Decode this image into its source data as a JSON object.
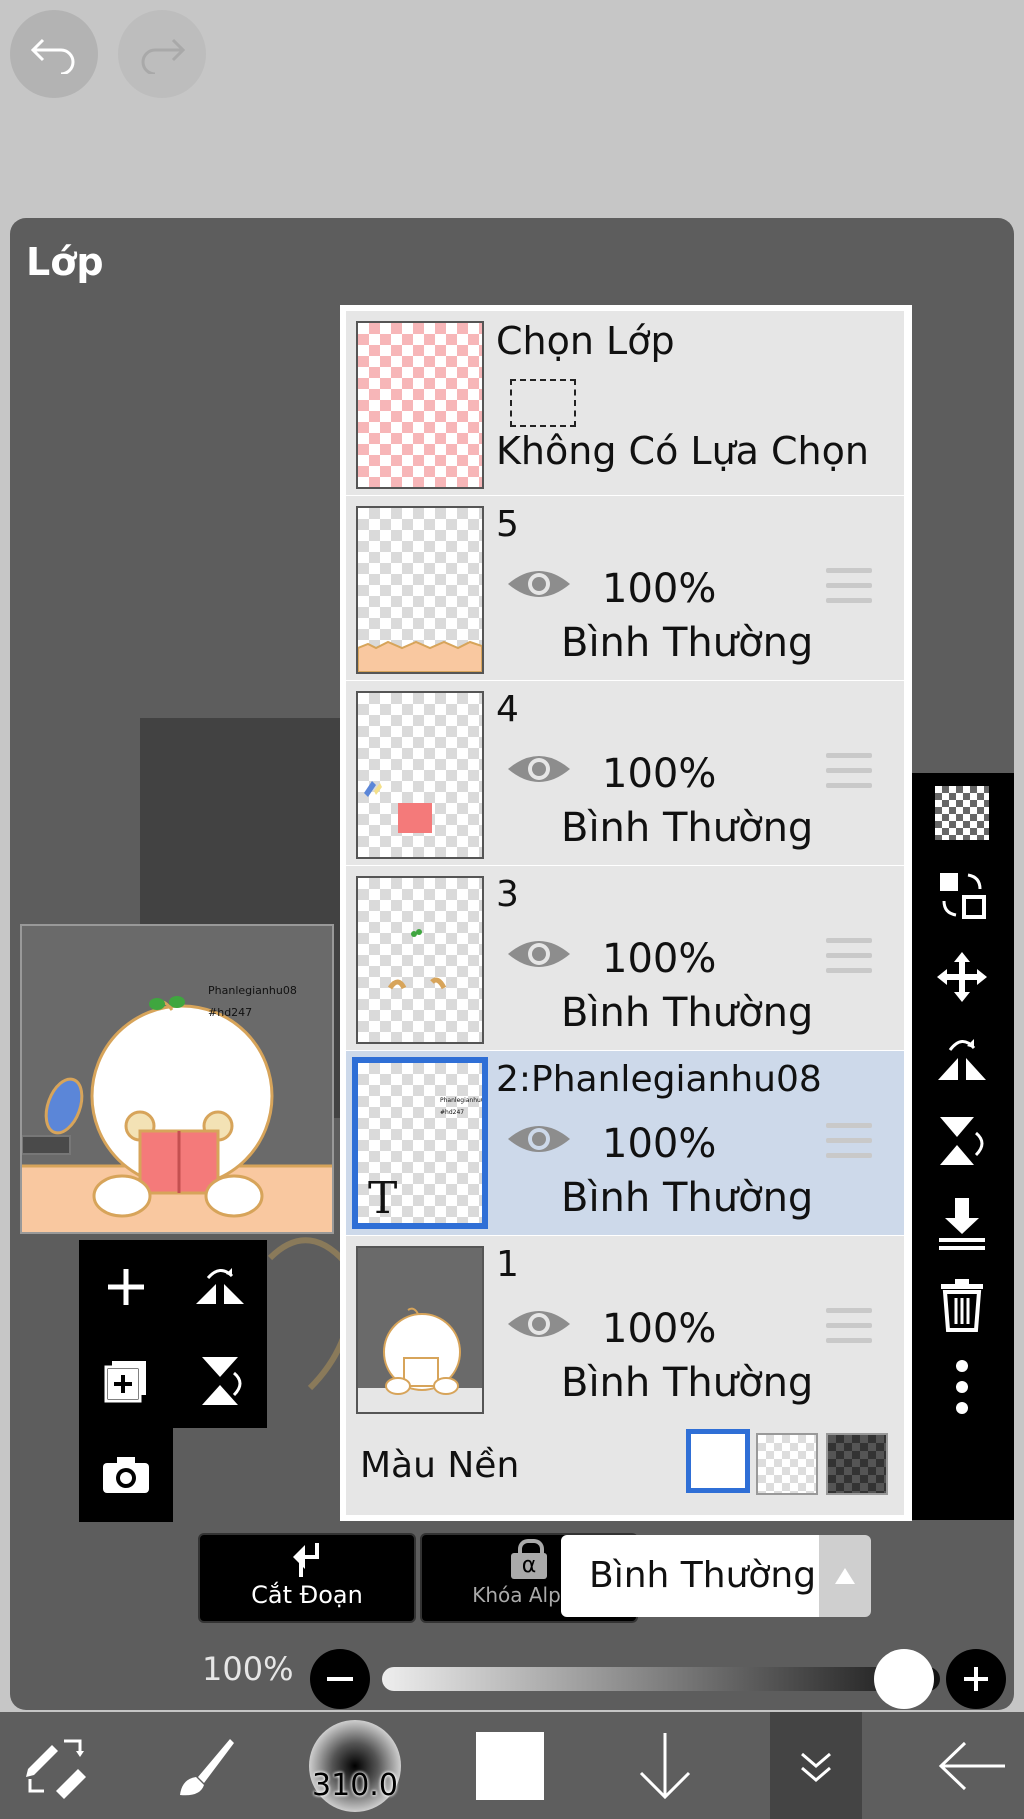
{
  "top_toolbar": {
    "undo_icon": "undo-icon",
    "redo_icon": "redo-icon"
  },
  "panel": {
    "title": "Lớp"
  },
  "preview": {
    "watermark_line1": "Phanlegianhu08",
    "watermark_line2": "#hd247"
  },
  "selection_layer": {
    "title": "Chọn Lớp",
    "subtitle": "Không Có Lựa Chọn"
  },
  "layers": [
    {
      "name": "5",
      "opacity": "100%",
      "blend": "Bình Thường",
      "visible": true
    },
    {
      "name": "4",
      "opacity": "100%",
      "blend": "Bình Thường",
      "visible": true
    },
    {
      "name": "3",
      "opacity": "100%",
      "blend": "Bình Thường",
      "visible": true
    },
    {
      "name": "2:Phanlegianhu08",
      "opacity": "100%",
      "blend": "Bình Thường",
      "visible": true,
      "selected": true,
      "is_text": true,
      "text_glyph": "T"
    },
    {
      "name": "1",
      "opacity": "100%",
      "blend": "Bình Thường",
      "visible": true
    }
  ],
  "background": {
    "label": "Màu Nền",
    "options": [
      "white",
      "transparent",
      "dark-checker"
    ],
    "selected": "white"
  },
  "actions": {
    "clipping_label": "Cắt Đoạn",
    "alpha_lock_label": "Khóa Alpha",
    "alpha_glyph": "α"
  },
  "blend_mode": {
    "value": "Bình Thường"
  },
  "opacity_slider": {
    "label": "100%",
    "value": 1.0
  },
  "bottom_bar": {
    "brush_size": "310.0"
  },
  "colors": {
    "selected_blue": "#2f6fd6",
    "panel_gray": "#5d5d5d",
    "selected_row": "#cdd9ea"
  }
}
